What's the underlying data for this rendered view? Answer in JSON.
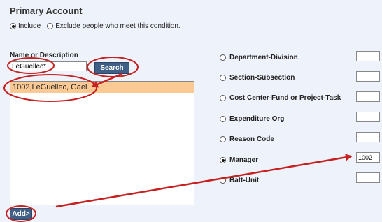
{
  "section_title": "Primary Account",
  "include_options": [
    {
      "label": "Include",
      "selected": true
    },
    {
      "label": "Exclude people who meet this condition.",
      "selected": false
    }
  ],
  "name_search": {
    "label": "Name or Description",
    "value": "LeGuellec*",
    "button_label": "Search"
  },
  "results": [
    "1002,LeGuellec, Gael"
  ],
  "add_button_label": "Add>",
  "criteria": [
    {
      "label": "Department-Division",
      "selected": false,
      "value": ""
    },
    {
      "label": "Section-Subsection",
      "selected": false,
      "value": ""
    },
    {
      "label": "Cost Center-Fund or Project-Task",
      "selected": false,
      "value": ""
    },
    {
      "label": "Expenditure Org",
      "selected": false,
      "value": ""
    },
    {
      "label": "Reason Code",
      "selected": false,
      "value": ""
    },
    {
      "label": "Manager",
      "selected": true,
      "value": "1002"
    },
    {
      "label": "Batt-Unit",
      "selected": false,
      "value": ""
    }
  ],
  "colors": {
    "annotation": "#c62020",
    "button": "#3f5f86",
    "highlight": "#fac994"
  }
}
